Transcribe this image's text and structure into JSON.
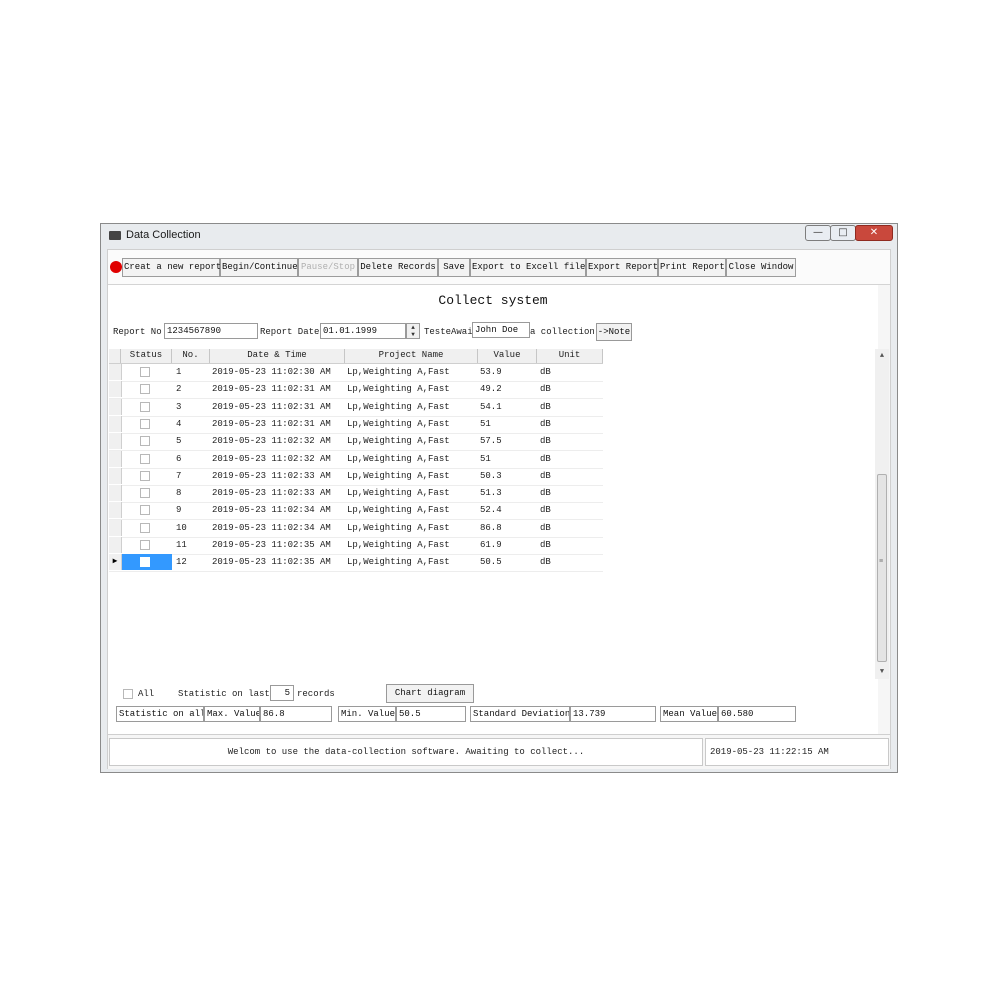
{
  "window": {
    "title": "Data Collection",
    "icon": "terminal-icon"
  },
  "window_controls": {
    "minimize": "—",
    "maximize": "□",
    "close": "✕"
  },
  "toolbar": {
    "buttons": [
      {
        "label": "Creat a new report"
      },
      {
        "label": "Begin/Continue"
      },
      {
        "label": "Pause/Stop",
        "disabled": true
      },
      {
        "label": "Delete Records"
      },
      {
        "label": "Save"
      },
      {
        "label": "Export to Excell file"
      },
      {
        "label": "Export Report"
      },
      {
        "label": "Print Report"
      },
      {
        "label": "Close Window"
      }
    ]
  },
  "form": {
    "heading": "Collect system",
    "report_no_label": "Report No",
    "report_no_value": "1234567890",
    "report_date_label": "Report Date",
    "report_date_value": "01.01.1999",
    "tester_label": "TesteAwai",
    "tester_value": "John Doe",
    "collection_label": "a collection",
    "note_button": "->Note"
  },
  "grid": {
    "columns": [
      "Status",
      "No.",
      "Date & Time",
      "Project Name",
      "Value",
      "Unit"
    ],
    "rows": [
      {
        "no": "1",
        "datetime": "2019-05-23 11:02:30 AM",
        "project": "Lp,Weighting A,Fast",
        "value": "53.9",
        "unit": "dB"
      },
      {
        "no": "2",
        "datetime": "2019-05-23 11:02:31 AM",
        "project": "Lp,Weighting A,Fast",
        "value": "49.2",
        "unit": "dB"
      },
      {
        "no": "3",
        "datetime": "2019-05-23 11:02:31 AM",
        "project": "Lp,Weighting A,Fast",
        "value": "54.1",
        "unit": "dB"
      },
      {
        "no": "4",
        "datetime": "2019-05-23 11:02:31 AM",
        "project": "Lp,Weighting A,Fast",
        "value": "51",
        "unit": "dB"
      },
      {
        "no": "5",
        "datetime": "2019-05-23 11:02:32 AM",
        "project": "Lp,Weighting A,Fast",
        "value": "57.5",
        "unit": "dB"
      },
      {
        "no": "6",
        "datetime": "2019-05-23 11:02:32 AM",
        "project": "Lp,Weighting A,Fast",
        "value": "51",
        "unit": "dB"
      },
      {
        "no": "7",
        "datetime": "2019-05-23 11:02:33 AM",
        "project": "Lp,Weighting A,Fast",
        "value": "50.3",
        "unit": "dB"
      },
      {
        "no": "8",
        "datetime": "2019-05-23 11:02:33 AM",
        "project": "Lp,Weighting A,Fast",
        "value": "51.3",
        "unit": "dB"
      },
      {
        "no": "9",
        "datetime": "2019-05-23 11:02:34 AM",
        "project": "Lp,Weighting A,Fast",
        "value": "52.4",
        "unit": "dB"
      },
      {
        "no": "10",
        "datetime": "2019-05-23 11:02:34 AM",
        "project": "Lp,Weighting A,Fast",
        "value": "86.8",
        "unit": "dB"
      },
      {
        "no": "11",
        "datetime": "2019-05-23 11:02:35 AM",
        "project": "Lp,Weighting A,Fast",
        "value": "61.9",
        "unit": "dB"
      },
      {
        "no": "12",
        "datetime": "2019-05-23 11:02:35 AM",
        "project": "Lp,Weighting A,Fast",
        "value": "50.5",
        "unit": "dB",
        "selected": true
      }
    ]
  },
  "scrollbar": {
    "up_arrow": "▲",
    "down_arrow": "▼",
    "grip": "≡"
  },
  "stats": {
    "all_label": "All",
    "last_label": "Statistic on last",
    "last_count": "5",
    "records_label": "records",
    "chart_button": "Chart diagram",
    "on_all_label": "Statistic on all",
    "max_label": "Max. Value",
    "max_value": "86.8",
    "min_label": "Min. Value",
    "min_value": "50.5",
    "std_label": "Standard Deviation",
    "std_value": "13.739",
    "mean_label": "Mean Value",
    "mean_value": "60.580"
  },
  "statusbar": {
    "message": "Welcom to use the data-collection software. Awaiting to collect...",
    "datetime": "2019-05-23 11:22:15 AM"
  }
}
